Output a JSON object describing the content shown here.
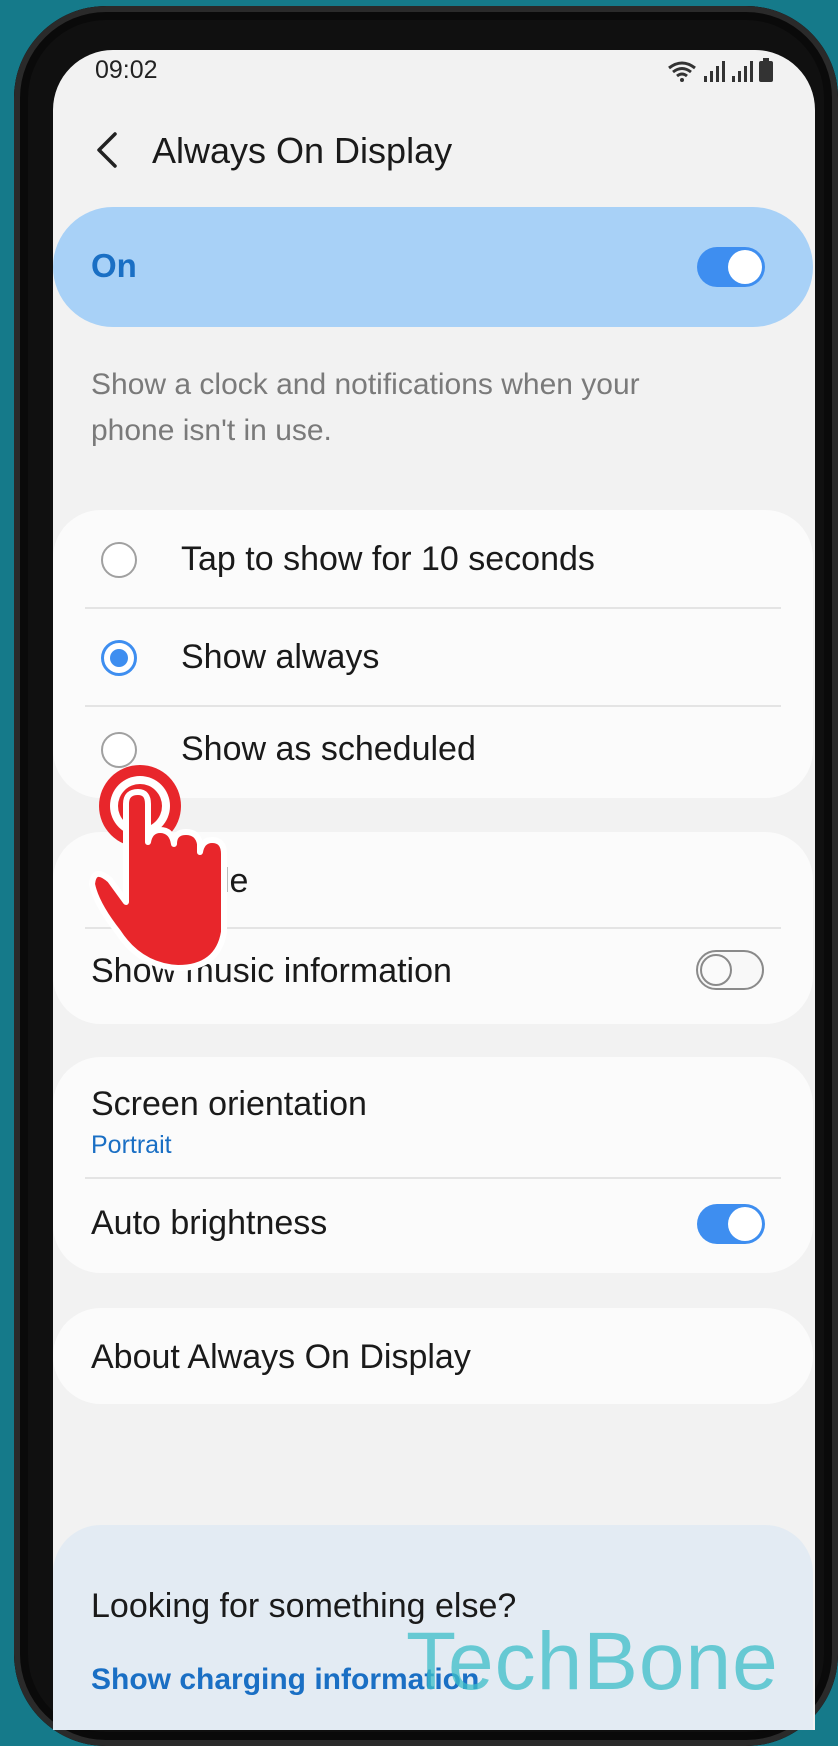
{
  "status": {
    "time": "09:02"
  },
  "header": {
    "title": "Always On Display"
  },
  "master": {
    "label": "On",
    "enabled": true
  },
  "description": "Show a clock and notifications when your phone isn't in use.",
  "display_modes": [
    {
      "label": "Tap to show for 10 seconds",
      "selected": false
    },
    {
      "label": "Show always",
      "selected": true
    },
    {
      "label": "Show as scheduled",
      "selected": false
    }
  ],
  "style_row": {
    "label": "Clock style",
    "visible_text": "yle"
  },
  "music_row": {
    "label": "Show music information",
    "enabled": false
  },
  "orientation": {
    "label": "Screen orientation",
    "value": "Portrait"
  },
  "brightness": {
    "label": "Auto brightness",
    "enabled": true
  },
  "about": {
    "label": "About Always On Display"
  },
  "suggestions": {
    "heading": "Looking for something else?",
    "link": "Show charging information"
  },
  "watermark": "TechBone",
  "colors": {
    "accent": "#3e8ef0",
    "on_bar": "#a8d1f7",
    "link": "#1a6fc4",
    "tap_indicator": "#e8262b",
    "backdrop": "#157a8a"
  }
}
